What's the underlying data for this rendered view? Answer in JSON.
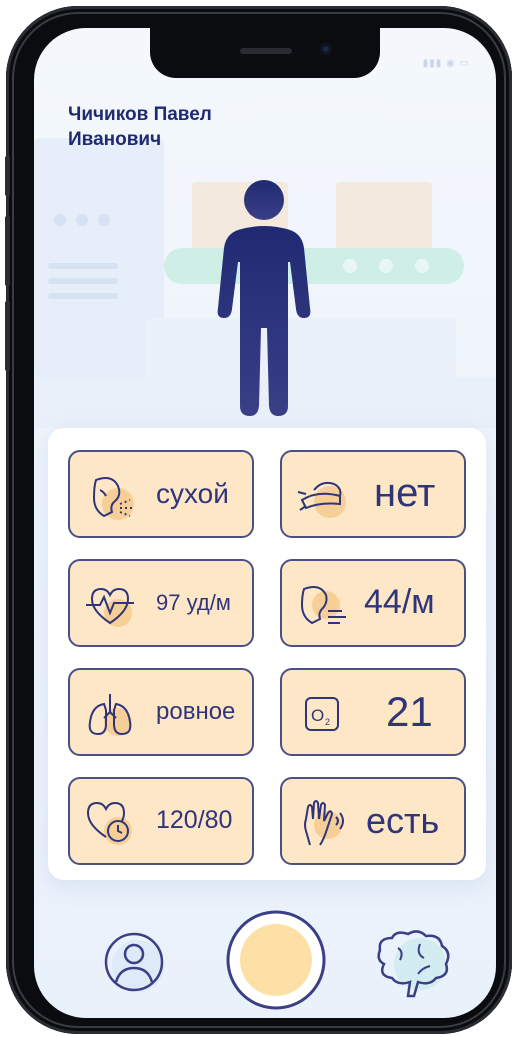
{
  "patient": {
    "name": "Чичиков Павел Иванович"
  },
  "vitals": [
    {
      "id": "cough",
      "icon": "cough-icon",
      "value": "сухой"
    },
    {
      "id": "sneeze",
      "icon": "sneeze-icon",
      "value": "нет"
    },
    {
      "id": "pulse",
      "icon": "heartbeat-icon",
      "value": "97 уд/м"
    },
    {
      "id": "breath-rate",
      "icon": "breathing-icon",
      "value": "44/м"
    },
    {
      "id": "breathing",
      "icon": "lungs-icon",
      "value": "ровное"
    },
    {
      "id": "oxygen",
      "icon": "o2-icon",
      "value": "21"
    },
    {
      "id": "pressure",
      "icon": "heart-pressure-icon",
      "value": "120/80"
    },
    {
      "id": "tremor",
      "icon": "hand-tremor-icon",
      "value": "есть"
    }
  ],
  "nav": {
    "items": [
      {
        "id": "profile",
        "icon": "profile-icon"
      },
      {
        "id": "record",
        "icon": "record-button-icon"
      },
      {
        "id": "brain",
        "icon": "brain-icon"
      }
    ]
  },
  "colors": {
    "accent": "#1f2a72",
    "tile_bg": "#fde7c6",
    "tile_border": "#4a4f86",
    "record_fill": "#fde0a6"
  }
}
